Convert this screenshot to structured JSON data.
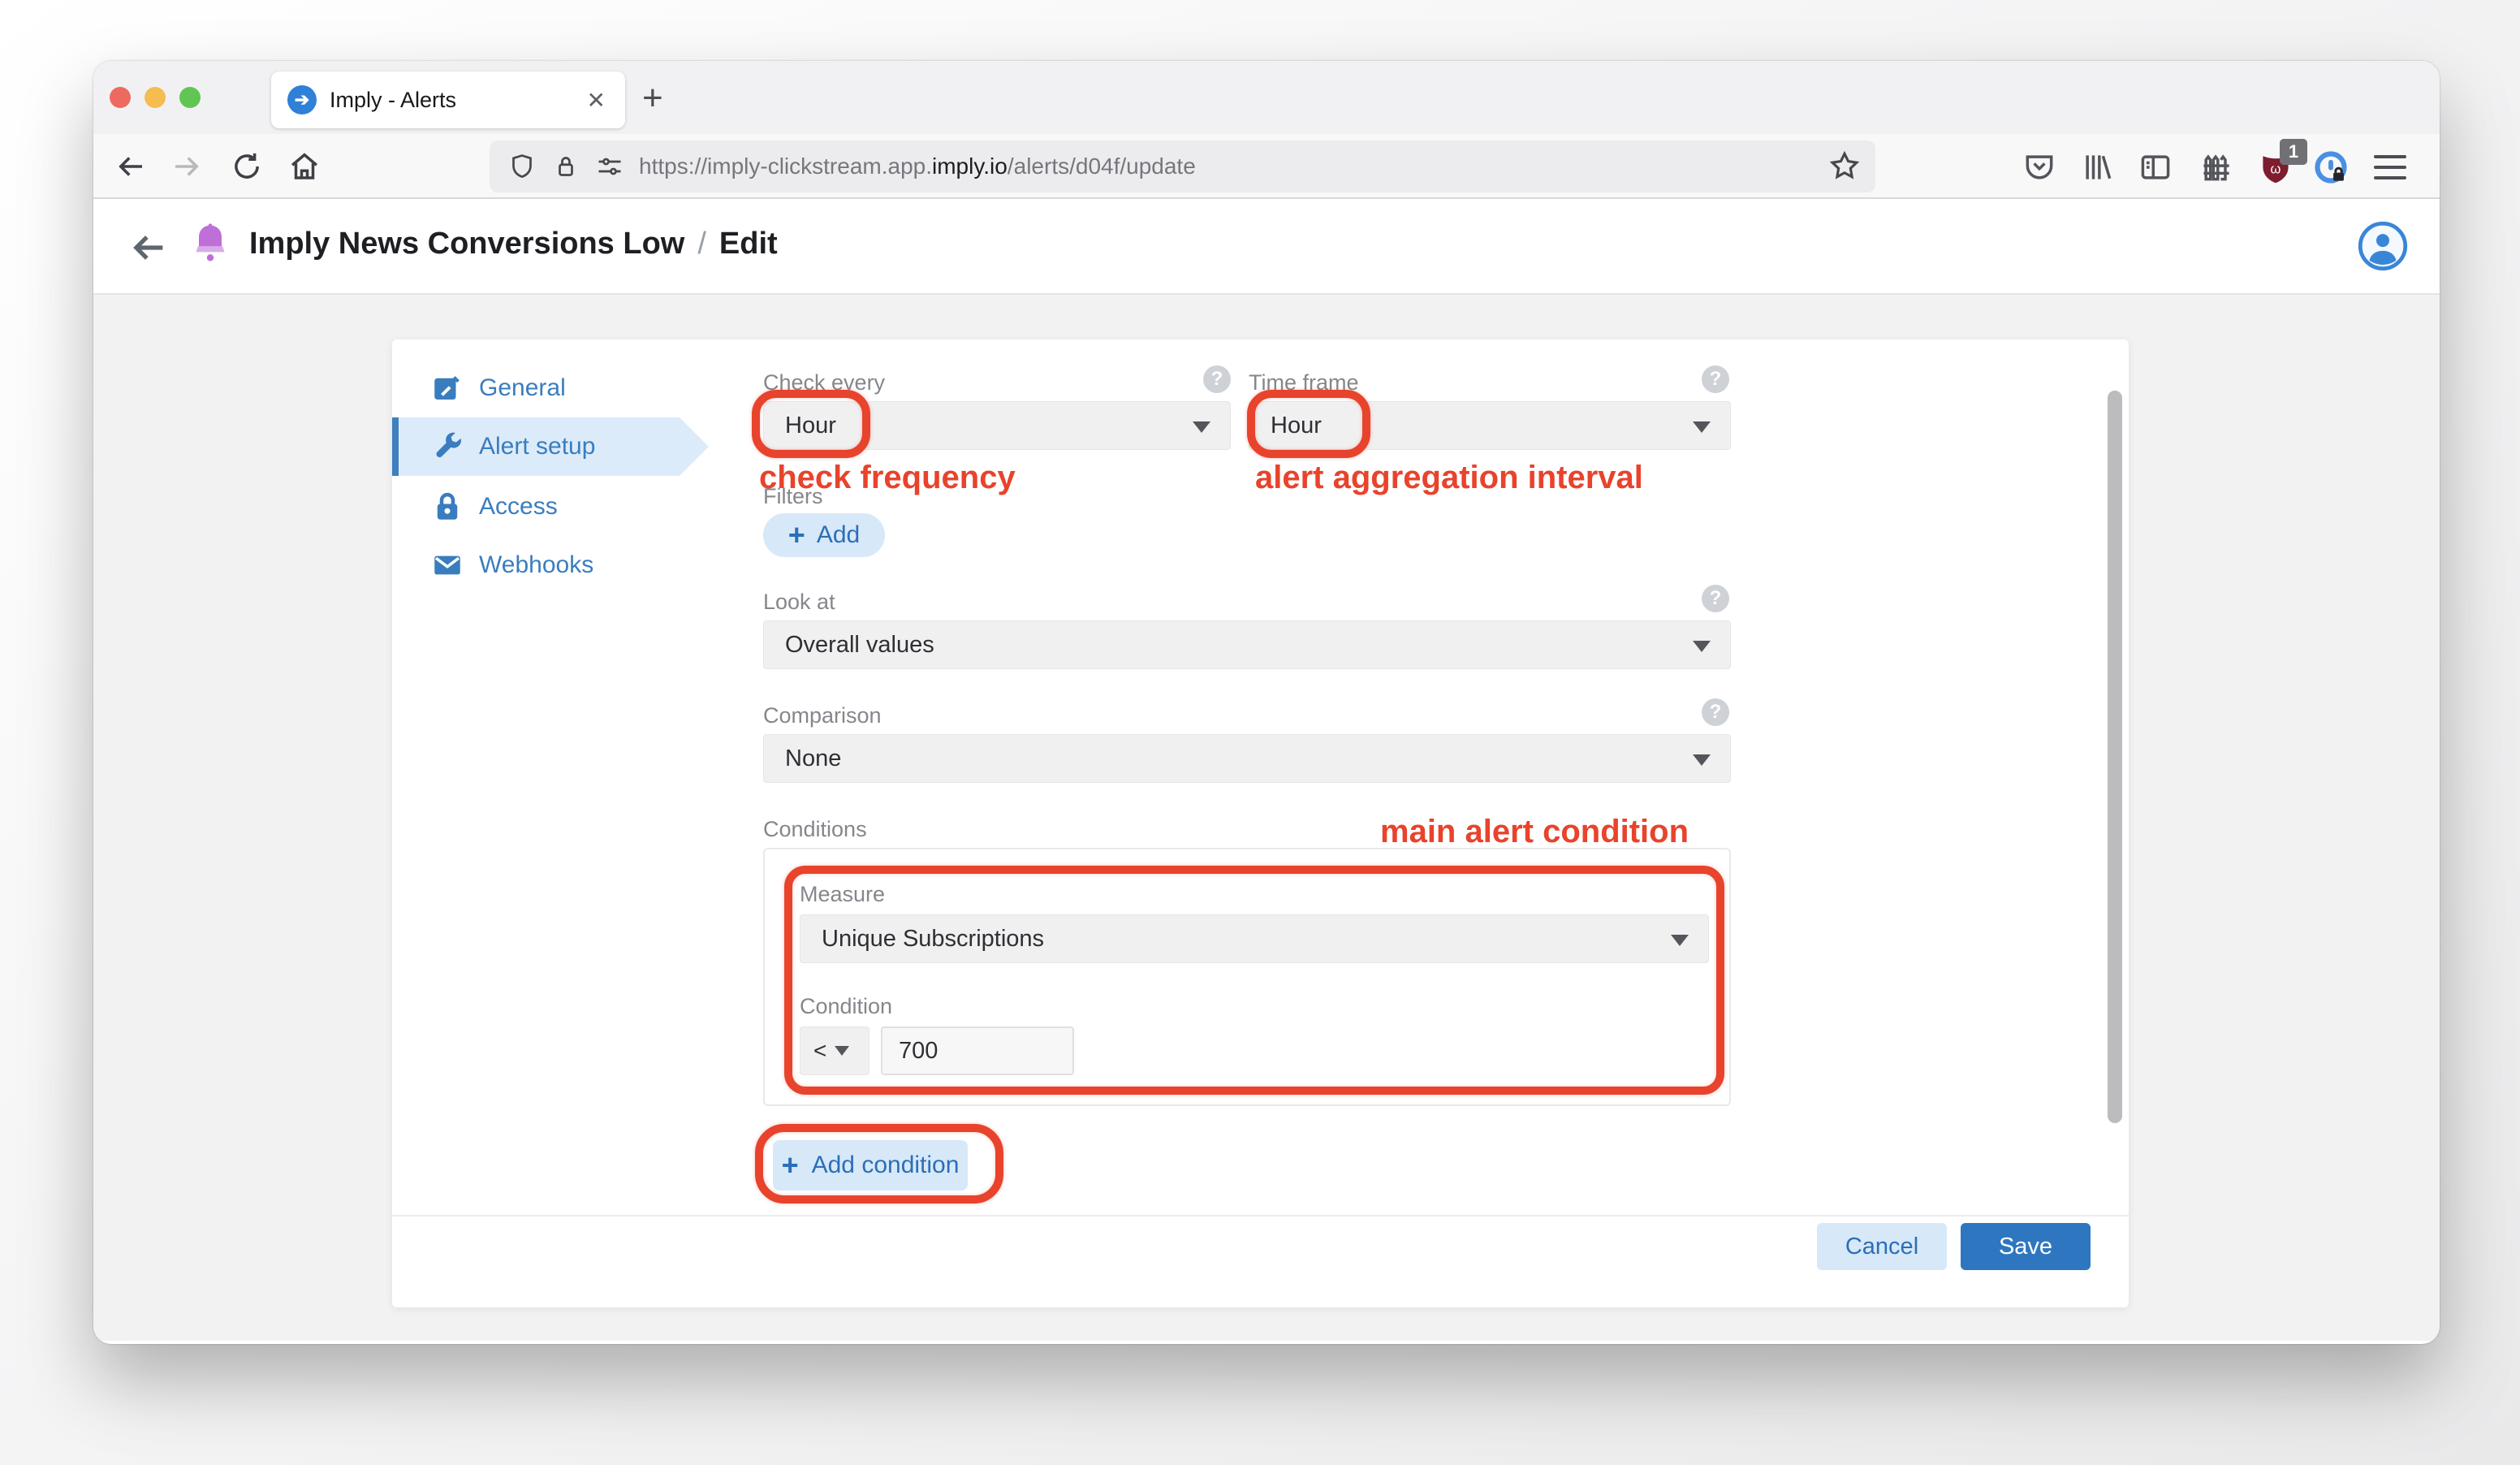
{
  "browser": {
    "tab_title": "Imply - Alerts",
    "close_glyph": "✕",
    "new_tab_glyph": "+",
    "favicon_glyph": "➔",
    "url": {
      "prefix": "https://imply-clickstream.app.",
      "domain": "imply.io",
      "suffix": "/alerts/d04f/update"
    },
    "extension_badge": "1"
  },
  "app": {
    "title": "Imply News Conversions Low",
    "separator": "/",
    "mode": "Edit"
  },
  "sidebar": {
    "items": [
      {
        "label": "General"
      },
      {
        "label": "Alert setup"
      },
      {
        "label": "Access"
      },
      {
        "label": "Webhooks"
      }
    ]
  },
  "form": {
    "check_every": {
      "label": "Check every",
      "value": "Hour"
    },
    "time_frame": {
      "label": "Time frame",
      "value": "Hour"
    },
    "filters": {
      "label": "Filters",
      "add": "Add"
    },
    "look_at": {
      "label": "Look at",
      "value": "Overall values"
    },
    "comparison": {
      "label": "Comparison",
      "value": "None"
    },
    "conditions": {
      "label": "Conditions",
      "measure_label": "Measure",
      "measure_value": "Unique Subscriptions",
      "condition_label": "Condition",
      "operator": "<",
      "threshold": "700",
      "add_condition": "Add condition"
    },
    "help_glyph": "?",
    "plus_glyph": "+"
  },
  "annotations": {
    "check_frequency": "check frequency",
    "aggregation_interval": "alert aggregation interval",
    "main_condition": "main alert condition",
    "color": "#e8432c"
  },
  "footer": {
    "cancel": "Cancel",
    "save": "Save"
  },
  "colors": {
    "accent_blue": "#2e77c0",
    "light_blue": "#d7e8f8",
    "annotation_red": "#e8432c",
    "nav_blue": "#3a7dbf"
  }
}
